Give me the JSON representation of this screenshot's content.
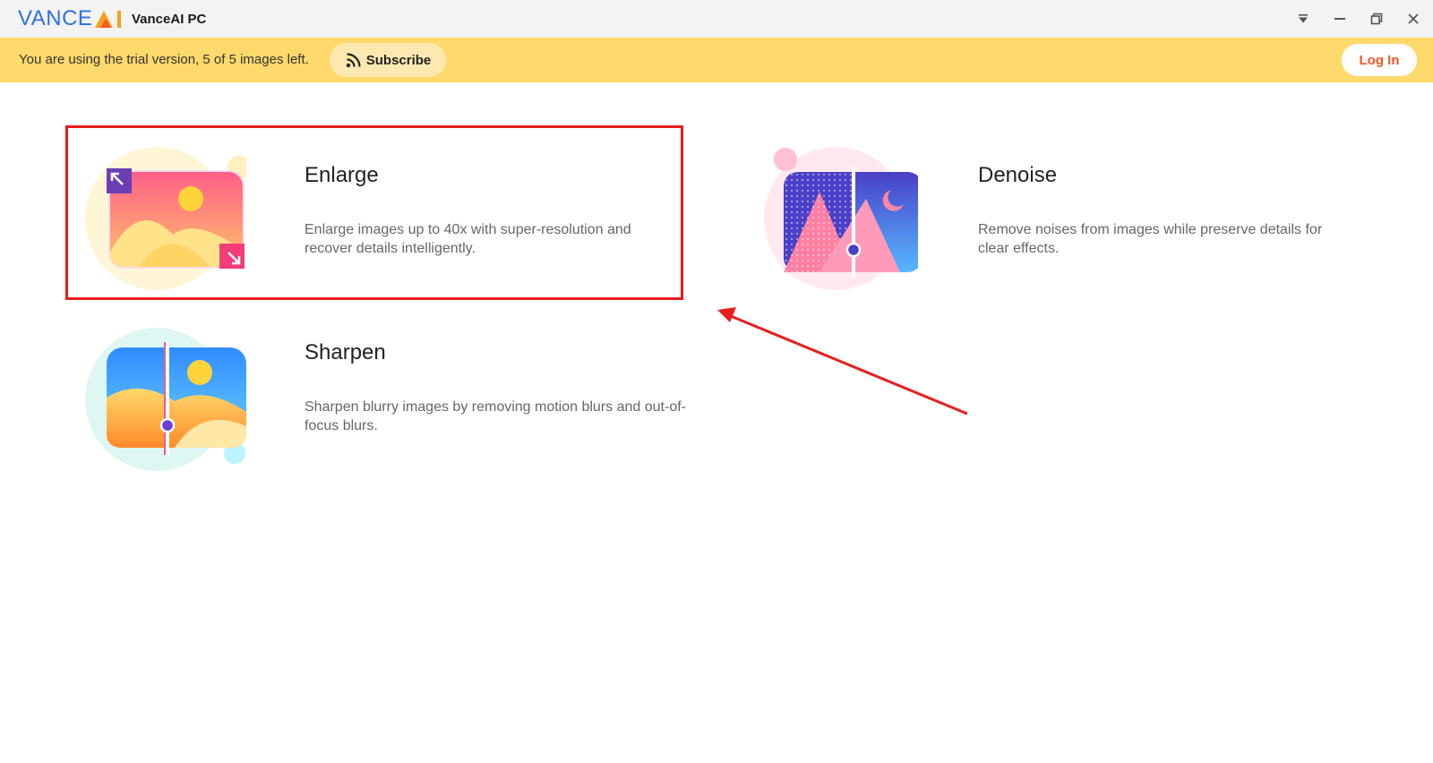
{
  "app": {
    "logo_text": "VANCE",
    "logo_ai": "AI",
    "title": "VanceAI PC"
  },
  "window_controls": [
    "dropdown-icon",
    "minimize-icon",
    "restore-icon",
    "close-icon"
  ],
  "banner": {
    "trial_text": "You are using the trial version, 5 of 5 images left.",
    "subscribe_label": "Subscribe",
    "login_label": "Log In"
  },
  "features": [
    {
      "title": "Enlarge",
      "description": "Enlarge images up to 40x with super-resolution and recover details intelligently.",
      "icon": "enlarge-icon"
    },
    {
      "title": "Denoise",
      "description": "Remove noises from images while preserve details for clear effects.",
      "icon": "denoise-icon"
    },
    {
      "title": "Sharpen",
      "description": "Sharpen blurry images by removing motion blurs and out-of-focus blurs.",
      "icon": "sharpen-icon"
    }
  ],
  "colors": {
    "banner_bg": "#ffd96b",
    "login_text": "#f0582a",
    "annotation": "#e81e1e",
    "logo_blue": "#2f6fe0"
  }
}
